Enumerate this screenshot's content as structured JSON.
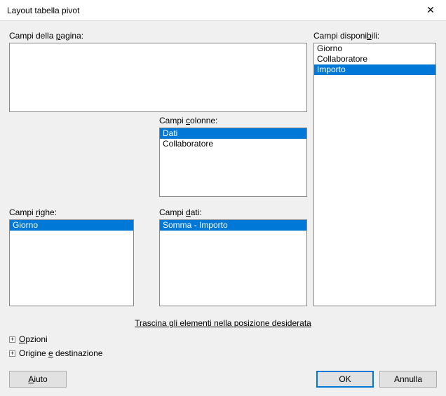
{
  "window": {
    "title": "Layout tabella pivot"
  },
  "labels": {
    "page_fields_pre": "Campi della ",
    "page_fields_u": "p",
    "page_fields_post": "agina:",
    "column_fields_pre": "Campi ",
    "column_fields_u": "c",
    "column_fields_post": "olonne:",
    "row_fields_pre": "Campi ",
    "row_fields_u": "r",
    "row_fields_post": "ighe:",
    "data_fields_pre": "Campi ",
    "data_fields_u": "d",
    "data_fields_post": "ati:",
    "available_fields_pre": "Campi disponi",
    "available_fields_u": "b",
    "available_fields_post": "ili:",
    "hint": "Trascina gli elementi nella posizione desiderata",
    "options_pre": "",
    "options_u": "O",
    "options_post": "pzioni",
    "source_pre": "Origine ",
    "source_u": "e",
    "source_post": " destinazione"
  },
  "lists": {
    "page": [],
    "columns": [
      {
        "text": "Dati",
        "selected": true
      },
      {
        "text": "Collaboratore",
        "selected": false
      }
    ],
    "rows": [
      {
        "text": "Giorno",
        "selected": true
      }
    ],
    "data": [
      {
        "text": "Somma - Importo",
        "selected": true
      }
    ],
    "available": [
      {
        "text": "Giorno",
        "selected": false
      },
      {
        "text": "Collaboratore",
        "selected": false
      },
      {
        "text": "Importo",
        "selected": true
      }
    ]
  },
  "buttons": {
    "help_pre": "",
    "help_u": "A",
    "help_post": "iuto",
    "ok": "OK",
    "cancel": "Annulla"
  }
}
